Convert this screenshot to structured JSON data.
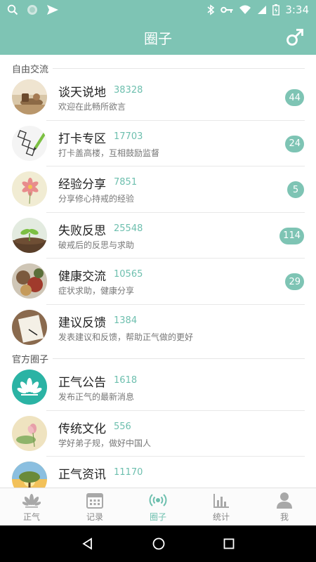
{
  "status_bar": {
    "time": "3:34"
  },
  "header": {
    "title": "圈子"
  },
  "sections": [
    {
      "title": "自由交流",
      "items": [
        {
          "title": "谈天说地",
          "count": "38328",
          "desc": "欢迎在此畅所欲言",
          "badge": "44"
        },
        {
          "title": "打卡专区",
          "count": "17703",
          "desc": "打卡盖高楼，互相鼓励监督",
          "badge": "24"
        },
        {
          "title": "经验分享",
          "count": "7851",
          "desc": "分享修心持戒的经验",
          "badge": "5"
        },
        {
          "title": "失败反思",
          "count": "25548",
          "desc": "破戒后的反思与求助",
          "badge": "114"
        },
        {
          "title": "健康交流",
          "count": "10565",
          "desc": "症状求助，健康分享",
          "badge": "29"
        },
        {
          "title": "建议反馈",
          "count": "1384",
          "desc": "发表建议和反馈，帮助正气做的更好",
          "badge": ""
        }
      ]
    },
    {
      "title": "官方圈子",
      "items": [
        {
          "title": "正气公告",
          "count": "1618",
          "desc": "发布正气的最新消息",
          "badge": ""
        },
        {
          "title": "传统文化",
          "count": "556",
          "desc": "学好弟子规，做好中国人",
          "badge": ""
        },
        {
          "title": "正气资讯",
          "count": "11170",
          "desc": "",
          "badge": ""
        }
      ]
    }
  ],
  "bottom_nav": [
    {
      "label": "正气",
      "icon": "lotus-icon"
    },
    {
      "label": "记录",
      "icon": "calendar-icon"
    },
    {
      "label": "圈子",
      "icon": "broadcast-icon",
      "active": true
    },
    {
      "label": "统计",
      "icon": "bar-chart-icon"
    },
    {
      "label": "我",
      "icon": "person-icon"
    }
  ],
  "colors": {
    "accent": "#7ec4b4",
    "count_text": "#6dbfae"
  }
}
